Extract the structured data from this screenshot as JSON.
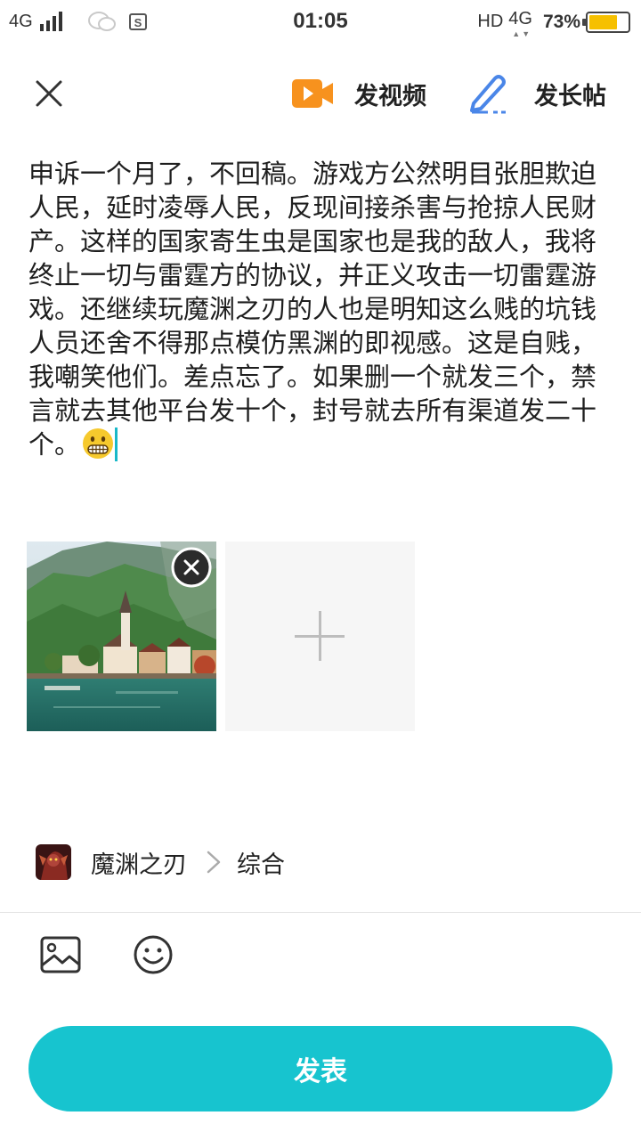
{
  "status_bar": {
    "network": "4G",
    "time": "01:05",
    "hd": "HD",
    "network_right": "4G",
    "battery_percent": "73%",
    "battery_level": 0.73,
    "battery_color": "#f6c000"
  },
  "top_bar": {
    "close_icon": "close-icon",
    "video_label": "发视频",
    "long_post_label": "发长帖",
    "accent_colors": {
      "video": "#f7921e",
      "pen": "#4a86e8"
    }
  },
  "post": {
    "text": "申诉一个月了，不回稿。游戏方公然明目张胆欺迫人民，延时凌辱人民，反现间接杀害与抢掠人民财产。这样的国家寄生虫是国家也是我的敌人，我将终止一切与雷霆方的协议，并正义攻击一切雷霆游戏。还继续玩魔渊之刃的人也是明知这么贱的坑钱人员还舍不得那点模仿黑渊的即视感。这是自贱，我嘲笑他们。差点忘了。如果删一个就发三个，禁言就去其他平台发十个，封号就去所有渠道发二十个。",
    "trailing_emoji": "grimacing-face-emoji"
  },
  "attachments": {
    "images": [
      {
        "description_icon": "lakeside-village-photo"
      }
    ],
    "add_icon": "plus-icon",
    "remove_icon": "close-circle-icon"
  },
  "topic": {
    "game_name": "魔渊之刃",
    "category": "综合"
  },
  "toolbar": {
    "image_icon": "image-icon",
    "emoji_icon": "smiley-icon"
  },
  "publish": {
    "label": "发表",
    "color": "#17c4cf"
  }
}
